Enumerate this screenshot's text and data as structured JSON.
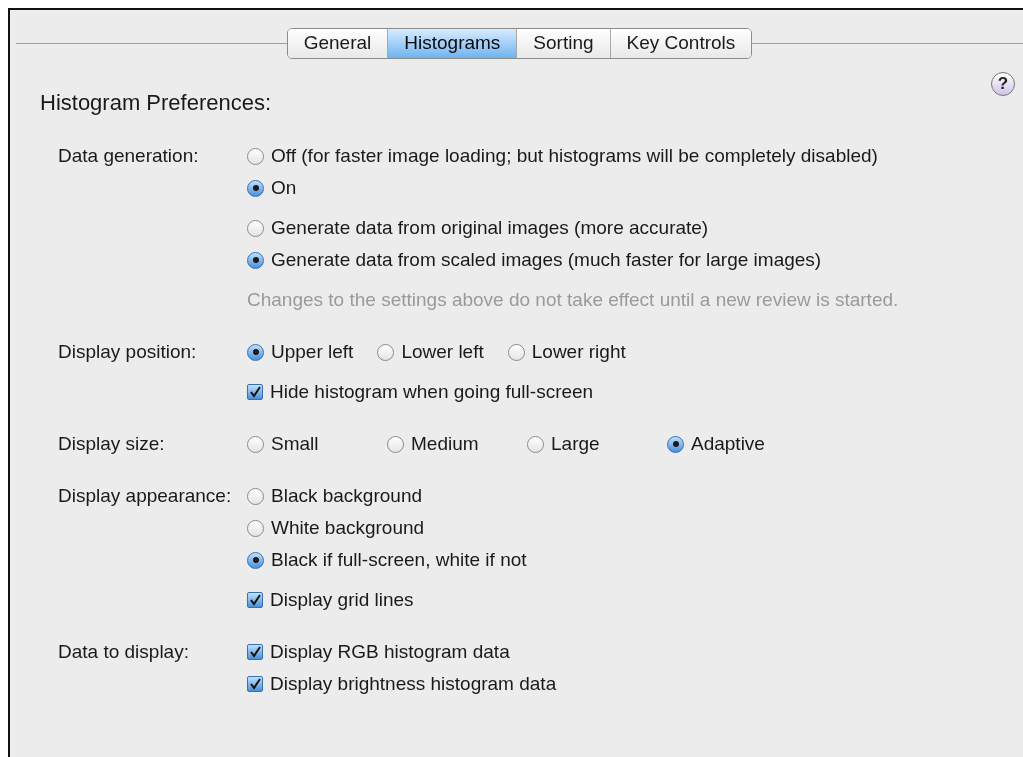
{
  "tabs": [
    {
      "label": "General",
      "selected": false
    },
    {
      "label": "Histograms",
      "selected": true
    },
    {
      "label": "Sorting",
      "selected": false
    },
    {
      "label": "Key Controls",
      "selected": false
    }
  ],
  "help": {
    "label": "?"
  },
  "title": "Histogram Preferences:",
  "sections": [
    {
      "label": "Data generation:",
      "groups": [
        {
          "kind": "radios",
          "items": [
            {
              "label": "Off (for faster image loading; but histograms will be completely disabled)",
              "selected": false
            },
            {
              "label": "On",
              "selected": true
            }
          ]
        },
        {
          "kind": "radios",
          "items": [
            {
              "label": "Generate data from original images (more accurate)",
              "selected": false
            },
            {
              "label": "Generate data from scaled images (much faster for large images)",
              "selected": true
            }
          ]
        },
        {
          "kind": "note",
          "text": "Changes to the settings above do not take effect until a new review is started."
        }
      ]
    },
    {
      "label": "Display position:",
      "groups": [
        {
          "kind": "radiorow",
          "items": [
            {
              "label": "Upper left",
              "selected": true
            },
            {
              "label": "Lower left",
              "selected": false
            },
            {
              "label": "Lower right",
              "selected": false
            }
          ]
        },
        {
          "kind": "checks",
          "items": [
            {
              "label": "Hide histogram when going full-screen",
              "checked": true
            }
          ]
        }
      ]
    },
    {
      "label": "Display size:",
      "groups": [
        {
          "kind": "radiogrid",
          "items": [
            {
              "label": "Small",
              "selected": false
            },
            {
              "label": "Medium",
              "selected": false
            },
            {
              "label": "Large",
              "selected": false
            },
            {
              "label": "Adaptive",
              "selected": true
            }
          ]
        }
      ]
    },
    {
      "label": "Display appearance:",
      "groups": [
        {
          "kind": "radios",
          "items": [
            {
              "label": "Black background",
              "selected": false
            },
            {
              "label": "White background",
              "selected": false
            },
            {
              "label": "Black if full-screen, white if not",
              "selected": true
            }
          ]
        },
        {
          "kind": "checks",
          "items": [
            {
              "label": "Display grid lines",
              "checked": true
            }
          ]
        }
      ]
    },
    {
      "label": "Data to display:",
      "groups": [
        {
          "kind": "checks",
          "items": [
            {
              "label": "Display RGB histogram data",
              "checked": true
            },
            {
              "label": "Display brightness histogram data",
              "checked": true
            }
          ]
        }
      ]
    }
  ]
}
